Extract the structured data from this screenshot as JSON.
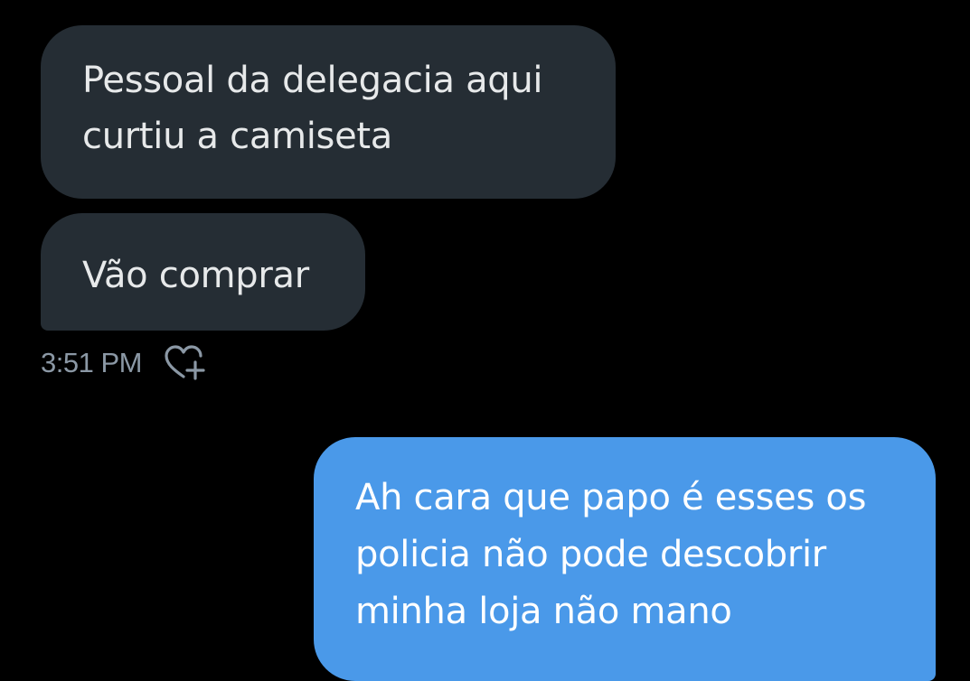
{
  "messages": {
    "incoming": [
      {
        "lines": [
          "Pessoal da delegacia aqui",
          "curtiu a camiseta"
        ]
      },
      {
        "lines": [
          "Vão comprar"
        ]
      }
    ],
    "incoming_meta": {
      "time": "3:51 PM",
      "react_icon": "heart-plus-icon"
    },
    "outgoing": [
      {
        "lines": [
          "Ah cara que papo é esses os",
          "policia não pode descobrir",
          "minha loja não mano"
        ]
      }
    ]
  },
  "colors": {
    "background": "#000000",
    "incoming_bubble": "#252d34",
    "outgoing_bubble": "#4a99e9",
    "timestamp": "#8b98a5"
  }
}
